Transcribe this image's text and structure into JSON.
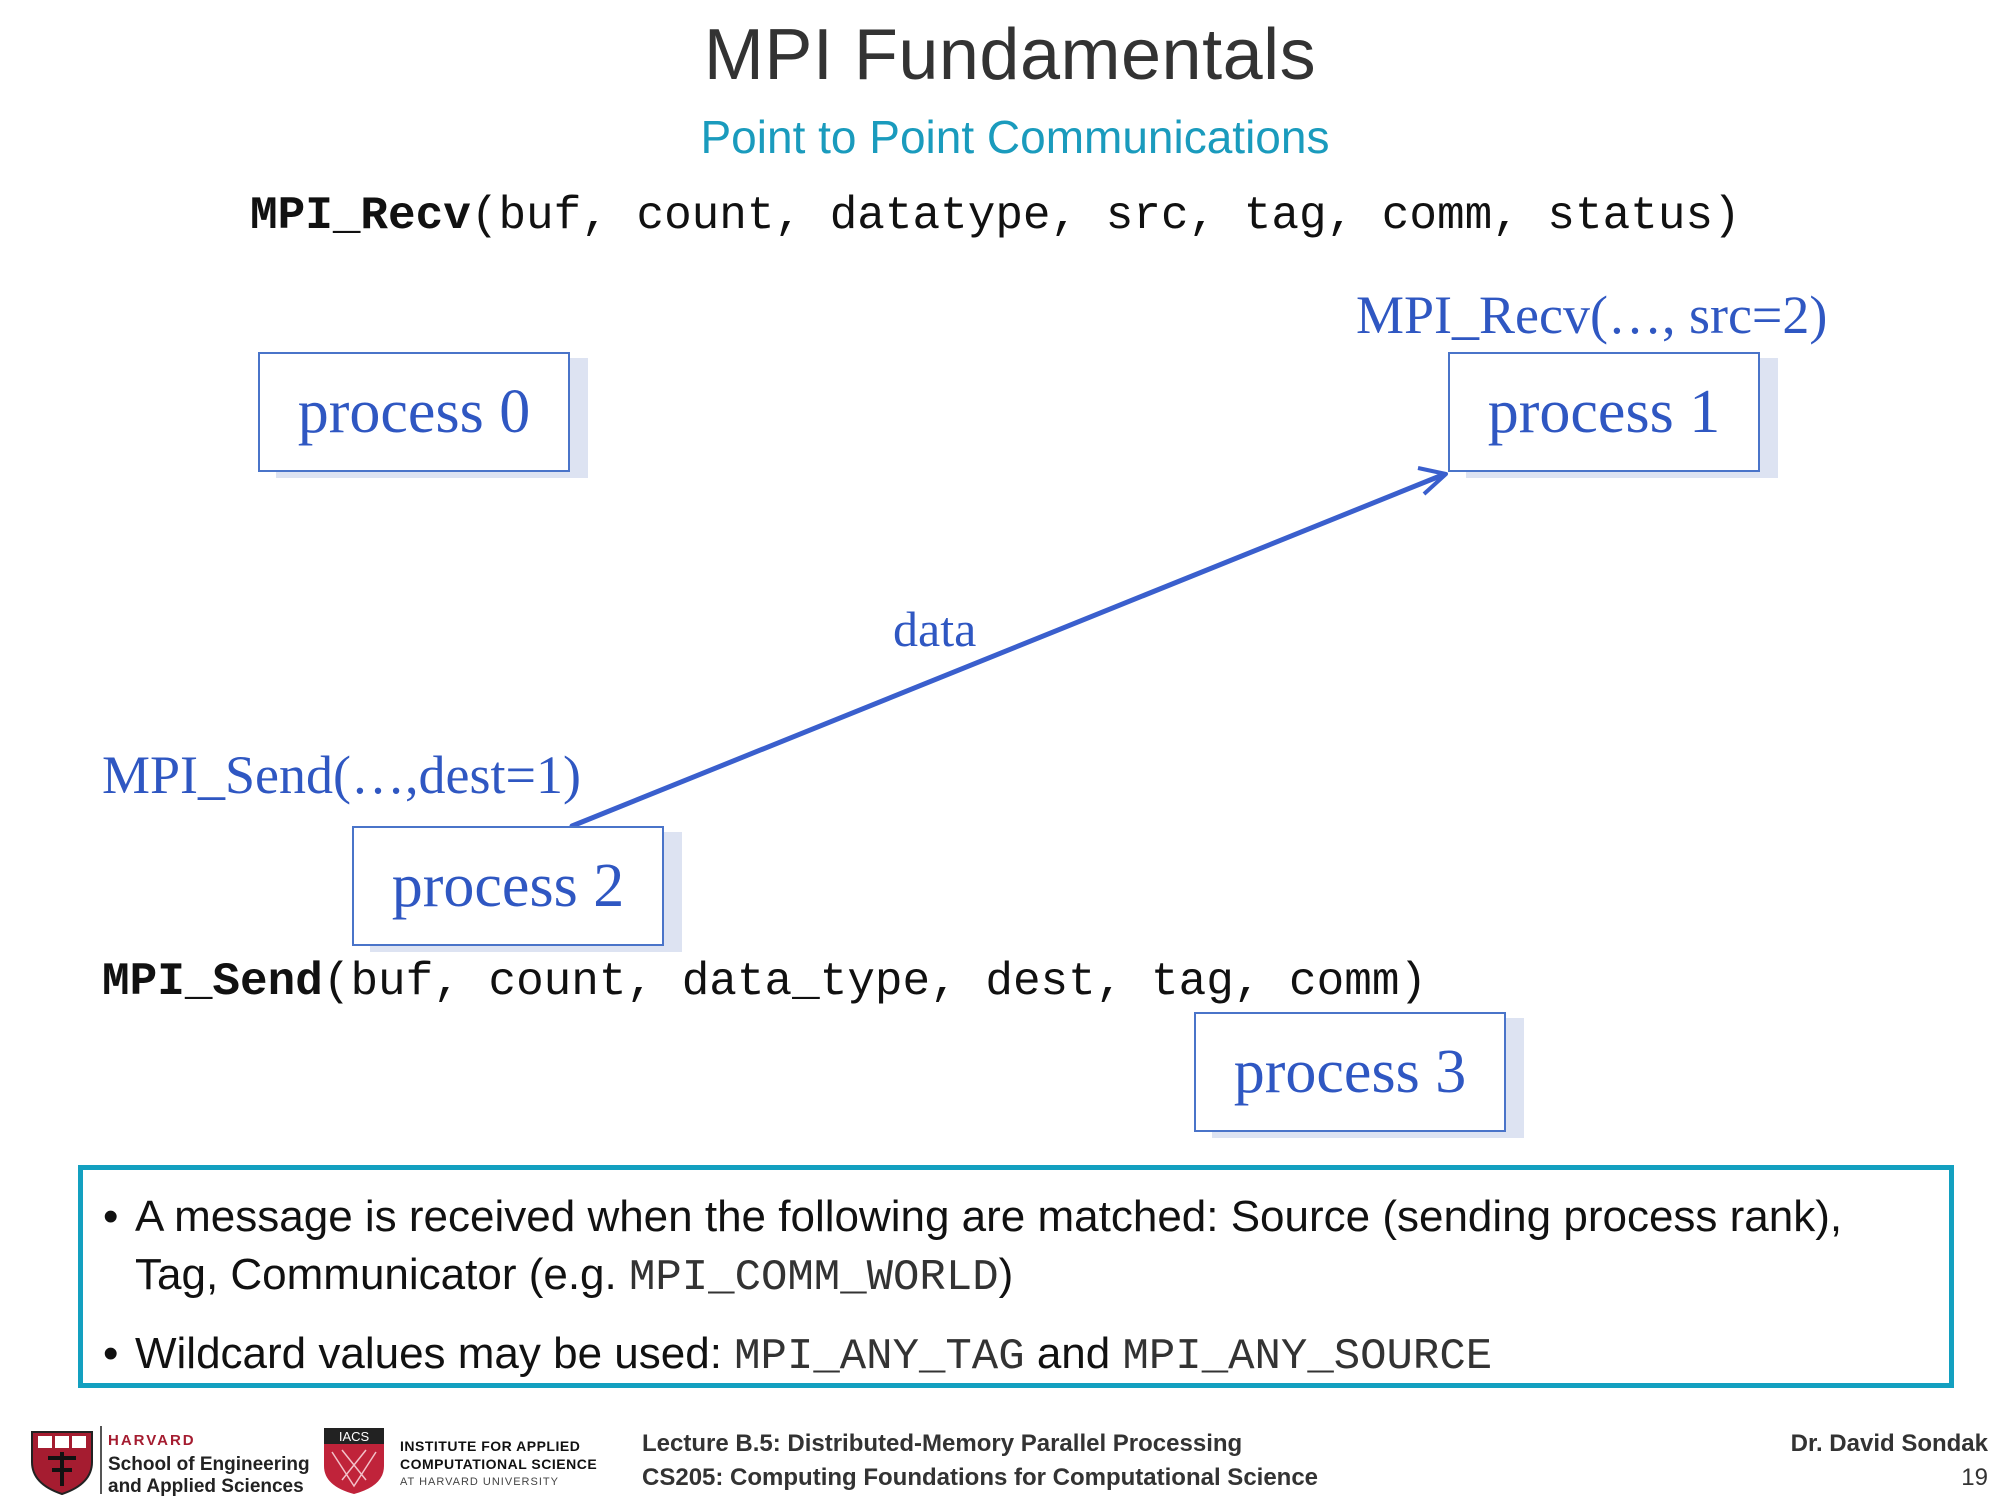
{
  "slide": {
    "title": "MPI Fundamentals",
    "subtitle": "Point to Point Communications"
  },
  "signatures": {
    "recv_name": "MPI_Recv",
    "recv_args": "(buf, count, datatype, src, tag, comm, status)",
    "send_name": "MPI_Send",
    "send_args": "(buf, count, data_type, dest, tag, comm)"
  },
  "diagram": {
    "processes": [
      "process 0",
      "process 1",
      "process 2",
      "process 3"
    ],
    "recv_call": "MPI_Recv(…, src=2)",
    "send_call": "MPI_Send(…,dest=1)",
    "arrow_label": "data",
    "line_color": "#3a5fcd"
  },
  "info": {
    "bullet_symbol": "•",
    "bullet1_text": "A message is received when the following are matched: Source (sending process rank),",
    "bullet1_line2_pre": "Tag, Communicator (e.g. ",
    "bullet1_code": "MPI_COMM_WORLD",
    "bullet1_post": ")",
    "bullet2_pre": "Wildcard values may be used: ",
    "bullet2_code1": "MPI_ANY_TAG",
    "bullet2_mid": " and ",
    "bullet2_code2": "MPI_ANY_SOURCE",
    "border_color": "#13a0c0"
  },
  "footer": {
    "harvard_name": "HARVARD",
    "harvard_school_line1": "School of Engineering",
    "harvard_school_line2": "and Applied Sciences",
    "iacs_abbrev": "IACS",
    "iacs_line1": "INSTITUTE FOR APPLIED",
    "iacs_line2": "COMPUTATIONAL SCIENCE",
    "iacs_line3": "AT HARVARD UNIVERSITY",
    "lecture": "Lecture B.5: Distributed-Memory Parallel Processing",
    "course": "CS205: Computing Foundations for Computational Science",
    "author": "Dr. David Sondak",
    "page_number": "19",
    "harvard_crimson": "#a51c30"
  }
}
